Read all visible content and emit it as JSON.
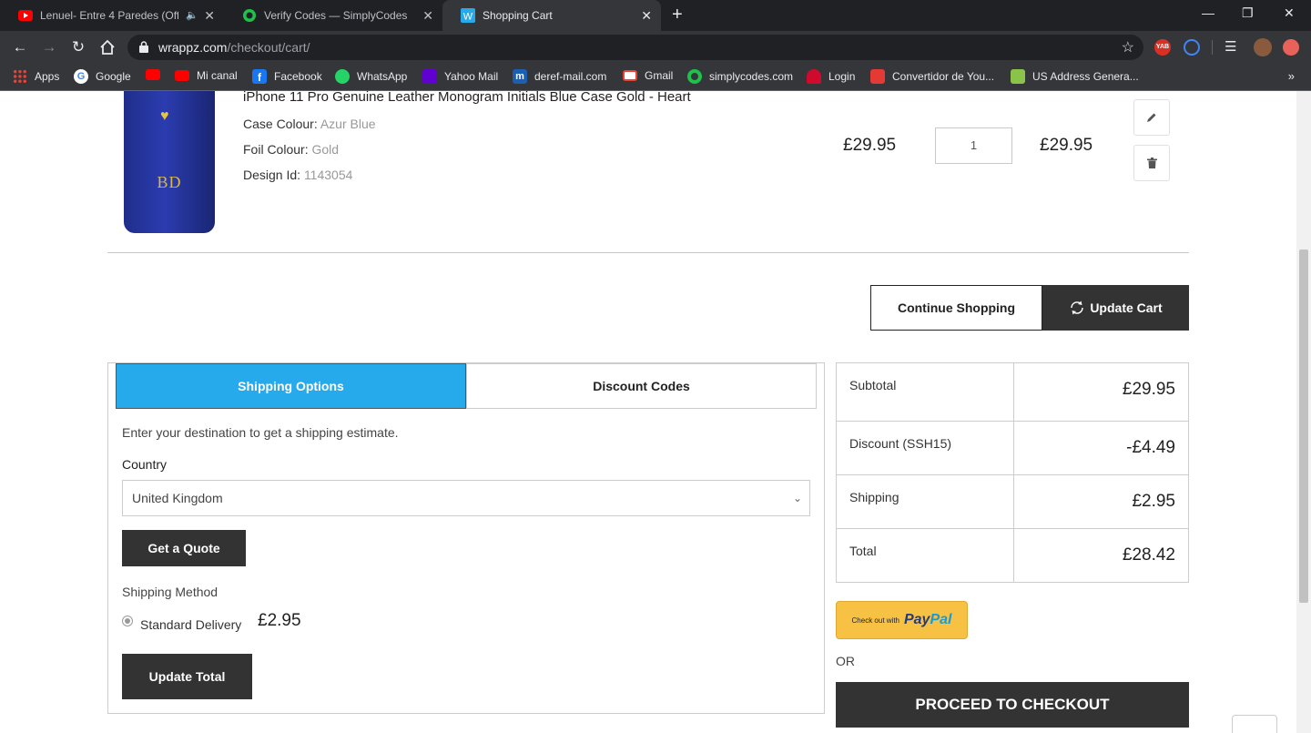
{
  "browser": {
    "tabs": [
      {
        "title": "Lenuel- Entre 4 Paredes (Offi"
      },
      {
        "title": "Verify Codes — SimplyCodes"
      },
      {
        "title": "Shopping Cart",
        "active": true
      }
    ],
    "url_host": "wrappz.com",
    "url_path": "/checkout/cart/",
    "bookmarks": [
      "Apps",
      "Google",
      "",
      "Mi canal",
      "Facebook",
      "WhatsApp",
      "Yahoo Mail",
      "deref-mail.com",
      "Gmail",
      "simplycodes.com",
      "Login",
      "Convertidor de You...",
      "US Address Genera..."
    ],
    "extension_badge": "YAB"
  },
  "product": {
    "name": "iPhone 11 Pro Genuine Leather Monogram Initials Blue Case Gold - Heart",
    "monogram": "BD",
    "attributes": [
      {
        "label": "Case Colour:",
        "value": "Azur Blue"
      },
      {
        "label": "Foil Colour:",
        "value": "Gold"
      },
      {
        "label": "Design Id:",
        "value": "1143054"
      }
    ],
    "price": "£29.95",
    "qty": "1",
    "subtotal": "£29.95"
  },
  "actions": {
    "continue": "Continue Shopping",
    "update": "Update Cart"
  },
  "shipping": {
    "tab_shipping": "Shipping Options",
    "tab_discount": "Discount Codes",
    "description": "Enter your destination to get a shipping estimate.",
    "country_label": "Country",
    "country_value": "United Kingdom",
    "quote_button": "Get a Quote",
    "method_label": "Shipping Method",
    "method_name": "Standard Delivery",
    "method_price": "£2.95",
    "update_total": "Update Total"
  },
  "totals": [
    {
      "label": "Subtotal",
      "value": "£29.95"
    },
    {
      "label": "Discount (SSH15)",
      "value": "-£4.49"
    },
    {
      "label": "Shipping",
      "value": "£2.95"
    },
    {
      "label": "Total",
      "value": "£28.42"
    }
  ],
  "checkout": {
    "paypal_prefix": "Check out with",
    "paypal_brand_a": "Pay",
    "paypal_brand_b": "Pal",
    "or": "OR",
    "proceed": "PROCEED TO CHECKOUT"
  },
  "colors": {
    "accent": "#27aaeb",
    "dark": "#333333",
    "paypal": "#f7c244"
  }
}
